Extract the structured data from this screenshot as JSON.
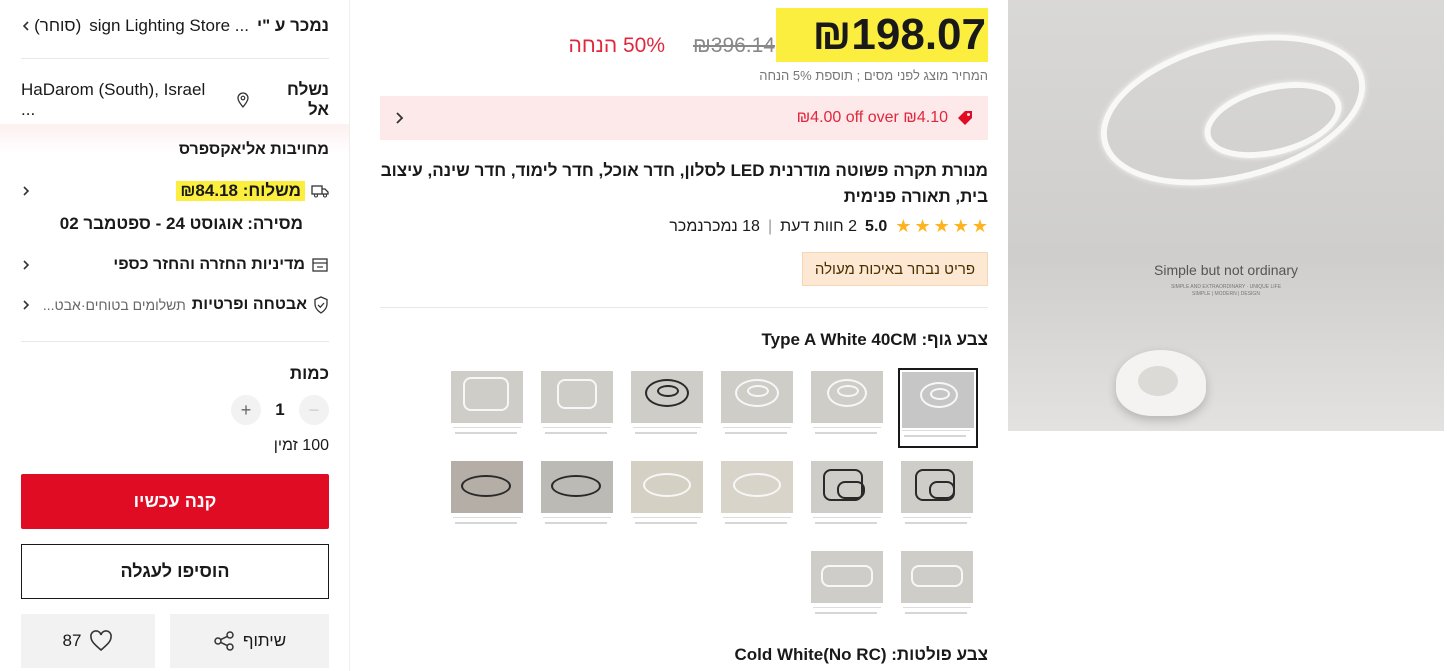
{
  "seller": {
    "label": "נמכר ע \"י",
    "name": "sign Lighting Store ...",
    "suffix": "(סוחר)"
  },
  "ship_to": {
    "label": "נשלח אל",
    "location": "HaDarom (South), Israel ..."
  },
  "commitment": {
    "title": "מחויבות אליאקספרס"
  },
  "shipping": {
    "label": "משלוח:",
    "price": "₪84.18",
    "delivery_label": "מסירה:",
    "delivery_dates": "אוגוסט 24 - ספטמבר 02"
  },
  "returns": {
    "label": "מדיניות החזרה והחזר כספי"
  },
  "security": {
    "label": "אבטחה ופרטיות",
    "detail": "תשלומים בטוחים·אבט..."
  },
  "quantity": {
    "label": "כמות",
    "value": "1",
    "minus": "−",
    "plus": "+",
    "stock": "100 זמין"
  },
  "buttons": {
    "buy_now": "קנה עכשיו",
    "add_to_cart": "הוסיפו לעגלה",
    "share": "שיתוף",
    "wishlist_count": "87"
  },
  "price": {
    "current": "₪198.07",
    "original": "₪396.14",
    "discount": "50% הנחה",
    "tax_note": "המחיר מוצג לפני מסים ; תוספת 5% הנחה"
  },
  "coupon": {
    "text": "₪4.00 off over ₪4.10"
  },
  "product": {
    "title": "מנורת תקרה פשוטה מודרנית LED לסלון, חדר אוכל, חדר לימוד, חדר שינה, עיצוב בית, תאורה פנימית",
    "rating": "5.0",
    "reviews": "2 חוות דעת",
    "sold": "18 נמכרנמכר",
    "badge": "פריט נבחר באיכות מעולה"
  },
  "options": {
    "body_color_label": "צבע גוף:",
    "body_color_value": "Type A White 40CM",
    "light_color_label": "צבע פולטות:",
    "light_color_value": "Cold White(No RC)"
  },
  "gallery": {
    "tagline": "Simple but not ordinary",
    "subline": "SIMPLE AND EXTRAORDINARY · UNIQUE LIFE",
    "subline2": "SIMPLE | MODERN | DESIGN"
  },
  "colors": {
    "accent_red": "#e00c24",
    "highlight": "#fbee3e",
    "star": "#fdb420"
  },
  "icons": [
    "location-pin-icon",
    "truck-icon",
    "return-box-icon",
    "shield-check-icon",
    "chevron-left-icon",
    "coupon-tag-icon",
    "star-icon",
    "share-icon",
    "heart-icon"
  ]
}
